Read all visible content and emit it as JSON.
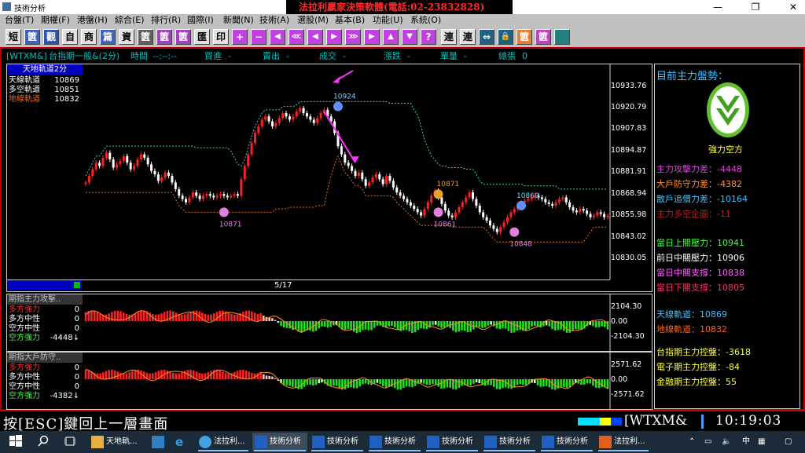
{
  "titlebar": {
    "title": "技術分析",
    "banner": "法拉利贏家決策軟體(電話:02-23832828)",
    "min": "—",
    "max": "❐",
    "close": "✕"
  },
  "menu": [
    "台盤(T)",
    "期權(F)",
    "港盤(H)",
    "綜合(E)",
    "排行(R)",
    "國際(I)",
    "新聞(N)",
    "技術(A)",
    "選股(M)",
    "基本(B)",
    "功能(U)",
    "系統(O)"
  ],
  "toolbar": {
    "short": "短",
    "b2": "篋",
    "b3": "觀",
    "self": "自",
    "b5": "商",
    "b6": "篇",
    "assets": "資",
    "b8": "篋",
    "b9": "篋",
    "b10": "篋",
    "transfer": "匯",
    "print": "印",
    "plus": "+",
    "minus": "−",
    "b15": "◀",
    "b16": "⋘",
    "b17": "◀",
    "b18": "▶",
    "b19": "⋙",
    "b20": "▶",
    "up": "▲",
    "down": "▼",
    "b23": "?",
    "link1": "連",
    "link2": "連",
    "b26": "⇔",
    "lock": "🔒",
    "b28": "篋",
    "b29": "篋"
  },
  "info": {
    "symbol": "[WTXM&]",
    "name": "台指期一般&(2分)",
    "time_label": "時間",
    "time_value": "--:--:--",
    "buy_label": "買進",
    "buy_value": "-",
    "sell_label": "賣出",
    "sell_value": "-",
    "deal_label": "成交",
    "deal_value": "-",
    "chg_label": "漲跌",
    "chg_value": "-",
    "vol_label": "單量",
    "vol_value": "-",
    "total_label": "總張",
    "total_value": "0"
  },
  "legend": {
    "header": "天地軌道2分",
    "rows": [
      {
        "label": "天線軌道",
        "value": "10869",
        "color": "#ffffff"
      },
      {
        "label": "多空軌道",
        "value": "10851",
        "color": "#ffffff"
      },
      {
        "label": "地線軌道",
        "value": "10832",
        "color": "#ff6020"
      }
    ]
  },
  "price_axis": [
    "10933.76",
    "10920.79",
    "10907.83",
    "10894.87",
    "10881.91",
    "10868.94",
    "10855.98",
    "10843.02",
    "10830.05"
  ],
  "chart_data": {
    "type": "candlestick",
    "ylim": [
      10825,
      10940
    ],
    "page": "5/17",
    "markers": [
      {
        "label": "10924",
        "x": 73,
        "y": 10924,
        "kind": "high",
        "color": "#6090ff"
      },
      {
        "label": "10871",
        "x": 40,
        "y": 10860,
        "kind": "low",
        "color": "#e080e0"
      },
      {
        "label": "10871",
        "x": 102,
        "y": 10871,
        "kind": "mid",
        "color": "#e8a030"
      },
      {
        "label": "10861",
        "x": 102,
        "y": 10860,
        "kind": "low",
        "color": "#e080e0"
      },
      {
        "label": "10869",
        "x": 126,
        "y": 10864,
        "kind": "high",
        "color": "#6090ff"
      },
      {
        "label": "10848",
        "x": 124,
        "y": 10848,
        "kind": "low",
        "color": "#e080e0"
      }
    ],
    "close": [
      10878,
      10882,
      10886,
      10890,
      10888,
      10893,
      10896,
      10892,
      10887,
      10889,
      10891,
      10894,
      10890,
      10886,
      10888,
      10892,
      10895,
      10893,
      10889,
      10885,
      10883,
      10879,
      10881,
      10884,
      10882,
      10878,
      10874,
      10870,
      10868,
      10866,
      10869,
      10872,
      10870,
      10868,
      10870,
      10871,
      10870,
      10869,
      10870,
      10871,
      10870,
      10869,
      10870,
      10871,
      10870,
      10880,
      10888,
      10895,
      10902,
      10908,
      10912,
      10916,
      10918,
      10915,
      10912,
      10914,
      10917,
      10920,
      10918,
      10916,
      10918,
      10921,
      10923,
      10920,
      10918,
      10916,
      10914,
      10917,
      10920,
      10922,
      10918,
      10915,
      10908,
      10900,
      10895,
      10890,
      10888,
      10885,
      10882,
      10884,
      10880,
      10876,
      10878,
      10881,
      10883,
      10880,
      10877,
      10882,
      10879,
      10875,
      10872,
      10870,
      10868,
      10866,
      10864,
      10862,
      10860,
      10858,
      10862,
      10866,
      10870,
      10873,
      10869,
      10865,
      10861,
      10858,
      10857,
      10860,
      10863,
      10866,
      10869,
      10872,
      10868,
      10864,
      10860,
      10857,
      10855,
      10852,
      10850,
      10848,
      10851,
      10854,
      10857,
      10860,
      10862,
      10864,
      10866,
      10867,
      10868,
      10869,
      10870,
      10869,
      10868,
      10866,
      10865,
      10864,
      10866,
      10868,
      10869,
      10866,
      10863,
      10861,
      10860,
      10862,
      10861,
      10859,
      10857,
      10858,
      10860,
      10859,
      10857,
      10858
    ],
    "bands": {
      "upper": [
        10884,
        10890
      ],
      "lower": [
        10865,
        10840
      ]
    }
  },
  "sub1": {
    "header": "期指主力攻擊..",
    "rows": [
      {
        "label": "多方強力",
        "value": "0",
        "color": "#ff3030"
      },
      {
        "label": "多方中性",
        "value": "0",
        "color": "#ffffff"
      },
      {
        "label": "空方中性",
        "value": "0",
        "color": "#ffffff"
      },
      {
        "label": "空方強力",
        "value": "-4448↓",
        "color": "#40ff40"
      }
    ],
    "axis": [
      "2104.30",
      "0.00",
      "-2104.30"
    ]
  },
  "sub2": {
    "header": "期指大戶防守..",
    "rows": [
      {
        "label": "多方強力",
        "value": "0",
        "color": "#ff3030"
      },
      {
        "label": "多方中性",
        "value": "0",
        "color": "#ffffff"
      },
      {
        "label": "空方中性",
        "value": "0",
        "color": "#ffffff"
      },
      {
        "label": "空方強力",
        "value": "-4382↓",
        "color": "#40ff40"
      }
    ],
    "axis": [
      "2571.62",
      "0.00",
      "-2571.62"
    ]
  },
  "side": {
    "title": "目前主力盤勢：",
    "trend": "強力空方",
    "rows": [
      {
        "text": "主力攻擊力差：-4448",
        "color": "#e040e0"
      },
      {
        "text": "大戶防守力差：-4382",
        "color": "#ff9030"
      },
      {
        "text": "散戶追價力差：-10164",
        "color": "#40c0ff"
      },
      {
        "text": "主力多空企圖：-11",
        "color": "#c02020"
      },
      {
        "text": "當日上關壓力：10941",
        "color": "#40ff40"
      },
      {
        "text": "前日中關壓力：10906",
        "color": "#ffffff"
      },
      {
        "text": "當日中關支撐：10838",
        "color": "#ff60ff"
      },
      {
        "text": "當日下關支撐：10805",
        "color": "#ff3060"
      },
      {
        "text": "天線軌道：10869",
        "color": "#40c0ff"
      },
      {
        "text": "地線軌道：10832",
        "color": "#ff6020"
      },
      {
        "text": "台指期主力控盤：-3618",
        "color": "#ffff40"
      },
      {
        "text": "電子期主力控盤：-84",
        "color": "#ffff40"
      },
      {
        "text": "金融期主力控盤：55",
        "color": "#ffff40"
      }
    ]
  },
  "bottom": {
    "esc": "按[ESC]鍵回上一層畫面",
    "symbol": "[WTXM&",
    "clock": "10:19:03"
  },
  "taskbar": {
    "items": [
      "天地軌...",
      "法拉利...",
      "技術分析",
      "技術分析",
      "技術分析",
      "技術分析",
      "技術分析",
      "技術分析",
      "法拉利..."
    ],
    "ime": "中"
  }
}
